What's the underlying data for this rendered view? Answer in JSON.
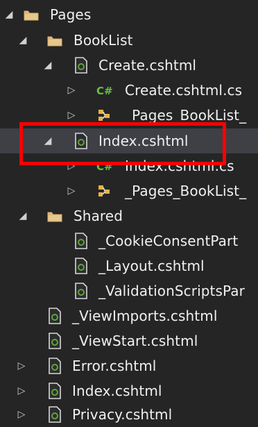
{
  "tree": {
    "items": [
      {
        "label": "Pages",
        "icon": "folder-icon",
        "expander": "expanded"
      },
      {
        "label": "BookList",
        "icon": "folder-icon",
        "expander": "expanded"
      },
      {
        "label": "Create.cshtml",
        "icon": "razor-file-icon",
        "expander": "expanded"
      },
      {
        "label": "Create.cshtml.cs",
        "icon": "csharp-file-icon",
        "expander": "collapsed"
      },
      {
        "label": "_Pages_BookList_",
        "icon": "generated-class-icon",
        "expander": "collapsed"
      },
      {
        "label": "Index.cshtml",
        "icon": "razor-file-icon",
        "expander": "expanded",
        "selected": true
      },
      {
        "label": "Index.cshtml.cs",
        "icon": "csharp-file-icon",
        "expander": "collapsed"
      },
      {
        "label": "_Pages_BookList_",
        "icon": "generated-class-icon",
        "expander": "collapsed"
      },
      {
        "label": "Shared",
        "icon": "folder-icon",
        "expander": "expanded"
      },
      {
        "label": "_CookieConsentPart",
        "icon": "razor-file-icon",
        "expander": "none"
      },
      {
        "label": "_Layout.cshtml",
        "icon": "razor-file-icon",
        "expander": "none"
      },
      {
        "label": "_ValidationScriptsPar",
        "icon": "razor-file-icon",
        "expander": "none"
      },
      {
        "label": "_ViewImports.cshtml",
        "icon": "razor-file-icon",
        "expander": "none"
      },
      {
        "label": "_ViewStart.cshtml",
        "icon": "razor-file-icon",
        "expander": "none"
      },
      {
        "label": "Error.cshtml",
        "icon": "razor-file-icon",
        "expander": "collapsed"
      },
      {
        "label": "Index.cshtml",
        "icon": "razor-file-icon",
        "expander": "collapsed"
      },
      {
        "label": "Privacy.cshtml",
        "icon": "razor-file-icon",
        "expander": "collapsed"
      }
    ]
  },
  "colors": {
    "background": "#252526",
    "selected": "#3f3f46",
    "folder": "#dcb67a",
    "csharp": "#68c040",
    "razor_accent": "#5ea53c",
    "highlight": "#ff0000"
  }
}
